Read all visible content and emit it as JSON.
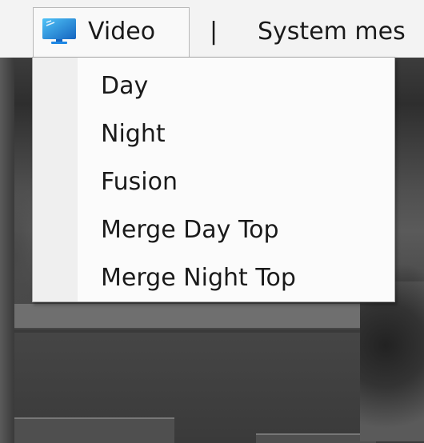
{
  "menubar": {
    "video_label": "Video",
    "separator": "|",
    "system_label": "System mes"
  },
  "dropdown": {
    "items": [
      {
        "label": "Day"
      },
      {
        "label": "Night"
      },
      {
        "label": "Fusion"
      },
      {
        "label": "Merge Day Top"
      },
      {
        "label": "Merge Night Top"
      }
    ]
  },
  "icons": {
    "video_menu_icon": "monitor-icon"
  },
  "colors": {
    "menubar_bg": "#f3f3f3",
    "dropdown_bg": "#fbfbfb",
    "monitor_blue": "#1e88e5"
  }
}
